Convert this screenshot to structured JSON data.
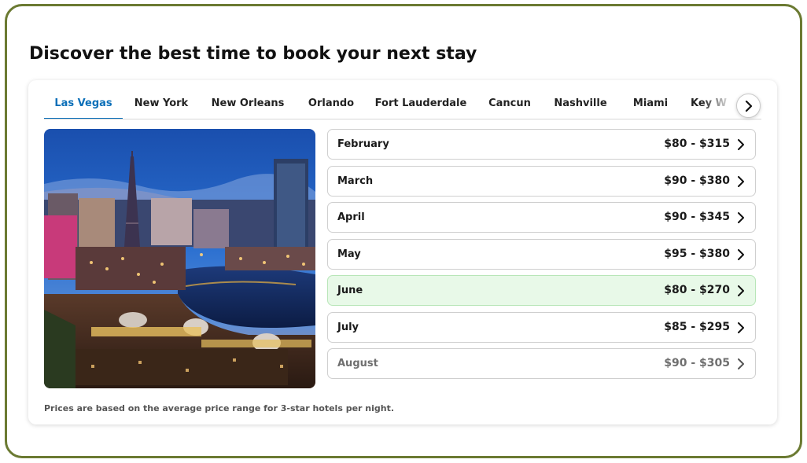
{
  "heading": "Discover the best time to book your next stay",
  "tabs": [
    {
      "label": "Las Vegas",
      "active": true
    },
    {
      "label": "New York"
    },
    {
      "label": "New Orleans"
    },
    {
      "label": "Orlando"
    },
    {
      "label": "Fort Lauderdale"
    },
    {
      "label": "Cancun"
    },
    {
      "label": "Nashville"
    },
    {
      "label": "Miami"
    },
    {
      "label": "Key W"
    }
  ],
  "months": [
    {
      "name": "February",
      "price": "$80 - $315"
    },
    {
      "name": "March",
      "price": "$90 - $380"
    },
    {
      "name": "April",
      "price": "$90 - $345"
    },
    {
      "name": "May",
      "price": "$95 - $380"
    },
    {
      "name": "June",
      "price": "$80 - $270",
      "highlight": true
    },
    {
      "name": "July",
      "price": "$85 - $295"
    },
    {
      "name": "August",
      "price": "$90 - $305"
    }
  ],
  "note": "Prices are based on the average price range for 3-star hotels per night.",
  "colors": {
    "frame": "#6b7a32",
    "accent": "#0b6fb8",
    "highlight": "#e8f9e8"
  },
  "icons": {
    "scroll": "chevron-right-icon",
    "row": "chevron-right-icon"
  }
}
